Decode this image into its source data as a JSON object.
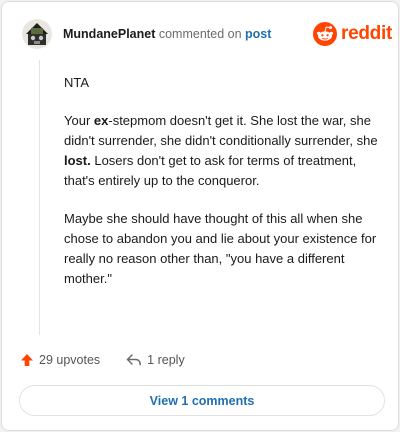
{
  "comment": {
    "username": "MundanePlanet",
    "action_text": "commented on",
    "post_link": "post",
    "brand": "reddit",
    "body": {
      "p1": "NTA",
      "p2": {
        "a": "Your ",
        "b1": "ex",
        "c": "-stepmom doesn't get it. She lost the war, she didn't surrender, she didn't conditionally surrender, she ",
        "b2": "lost.",
        "d": " Losers don't get to ask for terms of treatment, that's entirely up to the conqueror."
      },
      "p3": "Maybe she should have thought of this all when she chose to abandon you and lie about your existence for really no reason other than, \"you have a different mother.\""
    },
    "upvotes": "29 upvotes",
    "replies": "1 reply",
    "view_button": "View 1 comments"
  },
  "icons": {
    "avatar": "avatar-image",
    "brand_logo": "reddit-snoo-icon",
    "upvote": "upvote-arrow-icon",
    "reply": "reply-arrow-icon"
  },
  "colors": {
    "brand": "#ff4500",
    "link": "#1f6fb2",
    "text": "#1a1a1b",
    "muted": "#6b6b6b"
  }
}
